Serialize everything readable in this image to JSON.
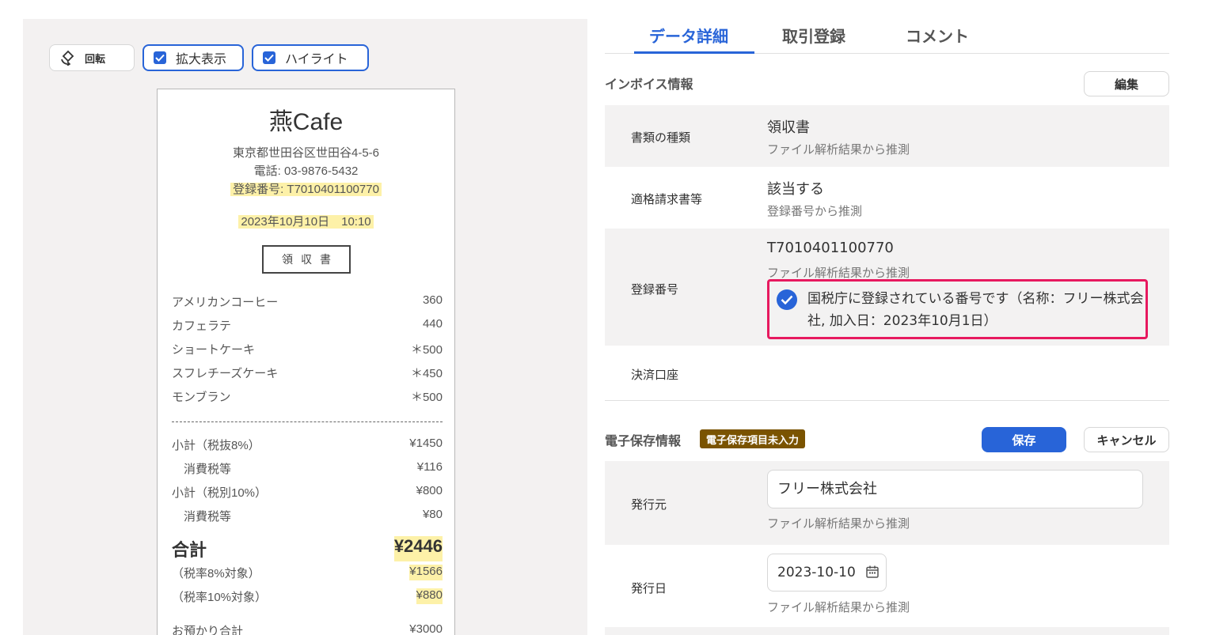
{
  "viewer": {
    "rotate_label": "回転",
    "zoom_label": "拡大表示",
    "highlight_label": "ハイライト"
  },
  "receipt": {
    "shop": "燕Cafe",
    "address": "東京都世田谷区世田谷4-5-6",
    "phone": "電話: 03-9876-5432",
    "reg_no": "登録番号: T7010401100770",
    "datetime": "2023年10月10日　10:10",
    "title": "領収書",
    "items": [
      {
        "name": "アメリカンコーヒー",
        "price": "360"
      },
      {
        "name": "カフェラテ",
        "price": "440"
      },
      {
        "name": "ショートケーキ",
        "price": "＊500"
      },
      {
        "name": "スフレチーズケーキ",
        "price": "＊450"
      },
      {
        "name": "モンブラン",
        "price": "＊500"
      }
    ],
    "subtotal8_label": "小計（税抜8%）",
    "subtotal8": "¥1450",
    "tax8_label": "消費税等",
    "tax8": "¥116",
    "subtotal10_label": "小計（税別10%）",
    "subtotal10": "¥800",
    "tax10_label": "消費税等",
    "tax10": "¥80",
    "total_label": "合計",
    "total": "¥2446",
    "rate8_label": "（税率8%対象）",
    "rate8": "¥1566",
    "rate10_label": "（税率10%対象）",
    "rate10": "¥880",
    "deposit_label": "お預かり合計",
    "deposit": "¥3000"
  },
  "tabs": [
    "データ詳細",
    "取引登録",
    "コメント"
  ],
  "invoice": {
    "title": "インボイス情報",
    "edit_label": "編集",
    "doc_type_label": "書類の種類",
    "doc_type_value": "領収書",
    "doc_type_hint": "ファイル解析結果から推測",
    "qualified_label": "適格請求書等",
    "qualified_value": "該当する",
    "qualified_hint": "登録番号から推測",
    "reg_label": "登録番号",
    "reg_value": "T7010401100770",
    "reg_hint": "ファイル解析結果から推測",
    "reg_verify": "国税庁に登録されている番号です（名称：フリー株式会社, 加入日：2023年10月1日）",
    "account_label": "決済口座"
  },
  "storage": {
    "title": "電子保存情報",
    "badge": "電子保存項目未入力",
    "save_label": "保存",
    "cancel_label": "キャンセル",
    "issuer_label": "発行元",
    "issuer_value": "フリー株式会社",
    "issuer_hint": "ファイル解析結果から推測",
    "date_label": "発行日",
    "date_value": "2023-10-10",
    "date_hint": "ファイル解析結果から推測"
  }
}
